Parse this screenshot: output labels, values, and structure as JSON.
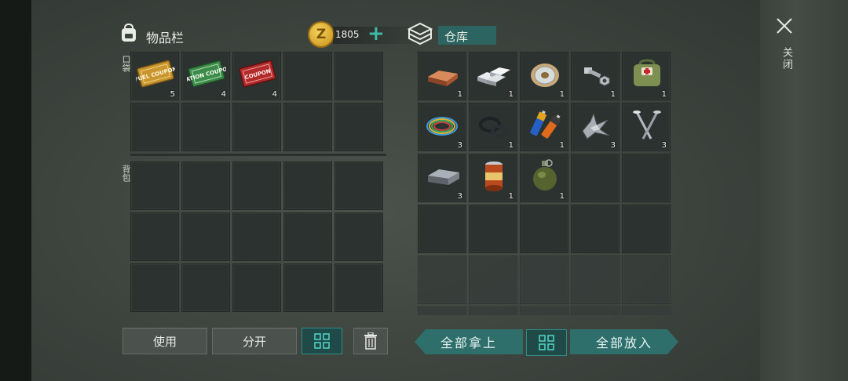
{
  "inventory": {
    "title": "物品栏",
    "pocket_label": "口袋",
    "backpack_label": "背包",
    "pocket_slots": [
      {
        "item": "fuel-coupon",
        "count": "5",
        "text": "FUEL COUPON"
      },
      {
        "item": "ration-coupon",
        "count": "4",
        "text": "RATION COUPON"
      },
      {
        "item": "combat-gear-coupon",
        "count": "4",
        "text": "COUPON"
      },
      {},
      {},
      {},
      {},
      {},
      {},
      {}
    ]
  },
  "currency": {
    "amount": "1805",
    "symbol": "Z",
    "add_label": "+"
  },
  "storage": {
    "title": "仓库",
    "slots": [
      {
        "item": "copper-ingot",
        "count": "1"
      },
      {
        "item": "aluminum-ingots",
        "count": "1"
      },
      {
        "item": "wire-spool",
        "count": "1"
      },
      {
        "item": "bolt-and-nut",
        "count": "1"
      },
      {
        "item": "medical-bag",
        "count": "1"
      },
      {
        "item": "copper-wires",
        "count": "3"
      },
      {
        "item": "rubber-seals",
        "count": "1"
      },
      {
        "item": "batteries",
        "count": "1"
      },
      {
        "item": "metal-scrap",
        "count": "3"
      },
      {
        "item": "nails",
        "count": "3"
      },
      {
        "item": "steel-ingot",
        "count": "3"
      },
      {
        "item": "canned-food",
        "count": "1"
      },
      {
        "item": "grenade",
        "count": "1"
      }
    ]
  },
  "buttons": {
    "use": "使用",
    "split": "分开",
    "take_all": "全部拿上",
    "put_all": "全部放入",
    "close": "关闭"
  },
  "colors": {
    "accent": "#2e6e6b",
    "gold": "#d9a520"
  }
}
